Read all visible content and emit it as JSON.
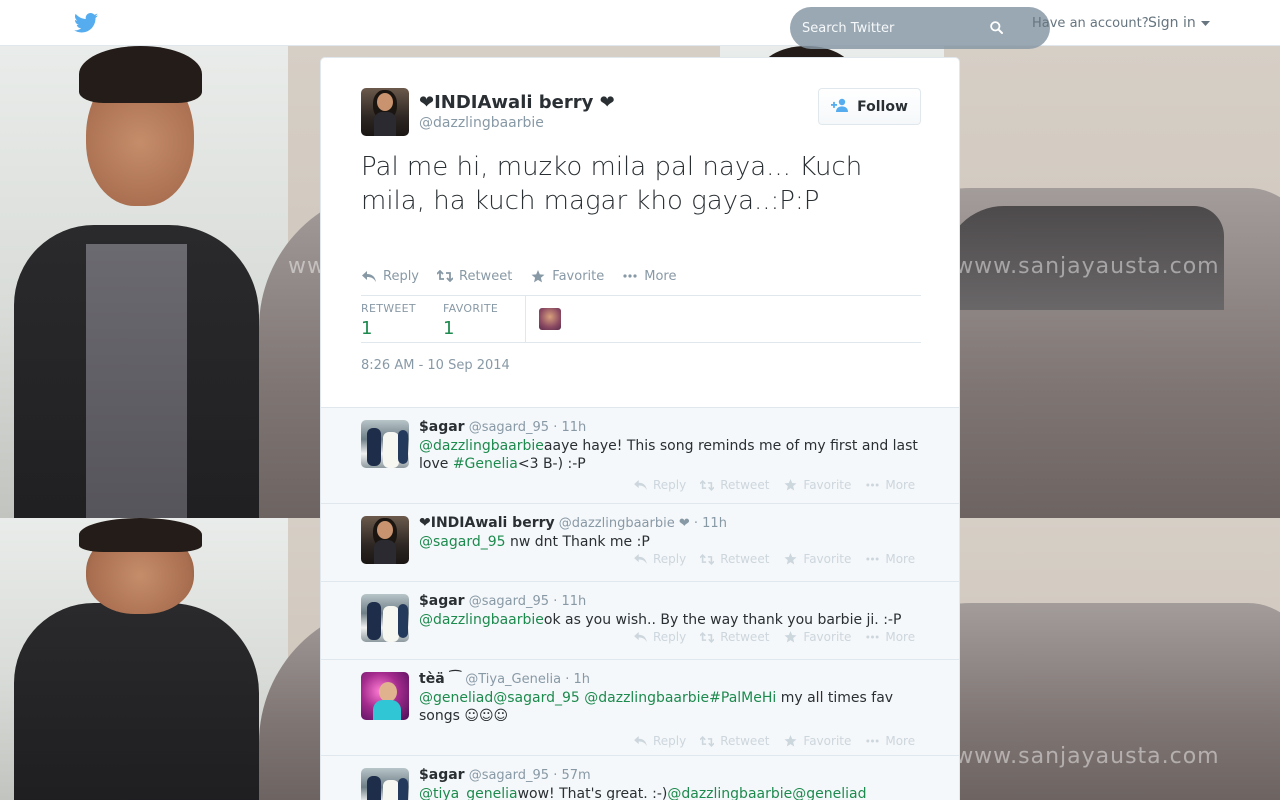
{
  "topbar": {
    "logo_icon": "twitter-bird-icon",
    "search_placeholder": "Search Twitter",
    "have_account": "Have an account?",
    "signin_label": "Sign in"
  },
  "background": {
    "watermark": "www.sanjayausta.com"
  },
  "tweet": {
    "fullname": "❤INDIAwali berry ❤",
    "username": "@dazzlingbaarbie",
    "follow_label": "Follow",
    "text": "Pal me hi, muzko mila pal naya... Kuch mila, ha kuch magar kho gaya..:P:P",
    "actions": {
      "reply": "Reply",
      "retweet": "Retweet",
      "favorite": "Favorite",
      "more": "More"
    },
    "stats": {
      "retweet_label": "RETWEET",
      "retweet_count": "1",
      "favorite_label": "FAVORITE",
      "favorite_count": "1"
    },
    "timestamp": "8:26 AM - 10 Sep 2014"
  },
  "replies": [
    {
      "name": "$agar",
      "user": "@sagard_95",
      "time": "· 11h",
      "avatar": "sagar",
      "segments": [
        {
          "t": "@dazzlingbaarbie",
          "m": true
        },
        {
          "t": "aaye haye! This song reminds me of my first and last love ",
          "m": false
        },
        {
          "t": "#Genelia",
          "m": true
        },
        {
          "t": "<3 B-) :-P",
          "m": false
        }
      ]
    },
    {
      "name": "❤INDIAwali berry",
      "user": "@dazzlingbaarbie",
      "time": " ❤ · 11h",
      "avatar": "india",
      "segments": [
        {
          "t": "@sagard_95",
          "m": true
        },
        {
          "t": " nw dnt Thank me :P",
          "m": false
        }
      ]
    },
    {
      "name": "$agar",
      "user": "@sagard_95",
      "time": "· 11h",
      "avatar": "sagar",
      "segments": [
        {
          "t": "@dazzlingbaarbie",
          "m": true
        },
        {
          "t": "ok as you wish.. By the way thank you barbie ji. :-P",
          "m": false
        }
      ]
    },
    {
      "name": "tèä ⁀",
      "user": "@Tiya_Genelia",
      "time": "· 1h",
      "avatar": "tiya",
      "segments": [
        {
          "t": "@geneliad",
          "m": true
        },
        {
          "t": "@sagard_95",
          "m": true
        },
        {
          "t": " ",
          "m": false
        },
        {
          "t": "@dazzlingbaarbie",
          "m": true
        },
        {
          "t": "#PalMeHi",
          "m": true
        },
        {
          "t": " my all times fav songs ☺☺☺",
          "m": false
        }
      ]
    },
    {
      "name": "$agar",
      "user": "@sagard_95",
      "time": "· 57m",
      "avatar": "sagar",
      "segments": [
        {
          "t": "@tiya_genelia",
          "m": true
        },
        {
          "t": "wow! That's great. :-)",
          "m": false
        },
        {
          "t": "@dazzlingbaarbie",
          "m": true
        },
        {
          "t": "@geneliad",
          "m": true
        }
      ]
    }
  ],
  "reply_actions": {
    "reply": "Reply",
    "retweet": "Retweet",
    "favorite": "Favorite",
    "more": "More"
  },
  "colors": {
    "accent": "#1d8a4e",
    "twitter_blue": "#55acee",
    "muted": "#8899a6"
  }
}
